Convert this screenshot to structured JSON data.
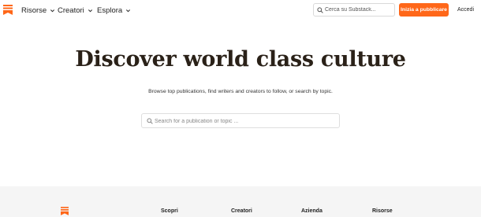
{
  "header": {
    "nav": [
      {
        "label": "Risorse"
      },
      {
        "label": "Creatori"
      },
      {
        "label": "Esplora"
      }
    ],
    "search_placeholder": "Cerca su Substack...",
    "start_button": "Inizia a pubblicare",
    "login": "Accedi"
  },
  "hero": {
    "title": "Discover world class culture",
    "subtitle": "Browse top publications, find writers and creators to follow, or search by topic.",
    "search_placeholder": "Search for a publication or topic ..."
  },
  "footer": {
    "columns": [
      {
        "title": "Scopri"
      },
      {
        "title": "Creatori"
      },
      {
        "title": "Azienda"
      },
      {
        "title": "Risorse"
      }
    ]
  },
  "colors": {
    "accent": "#ff6719",
    "footer_bg": "#f5f5f5"
  }
}
